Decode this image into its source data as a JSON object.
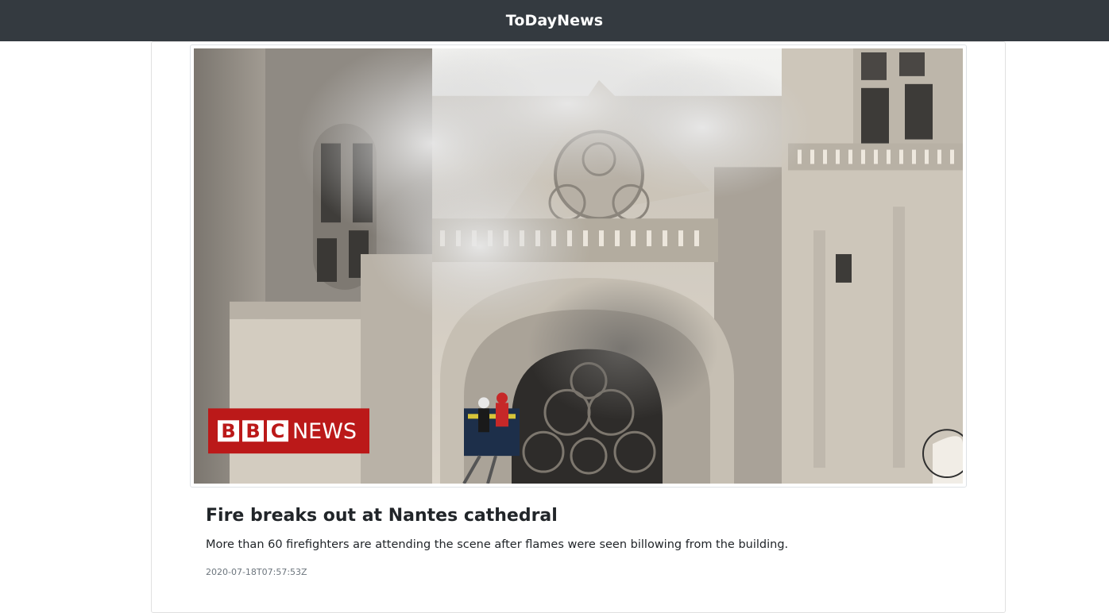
{
  "navbar": {
    "brand": "ToDayNews",
    "background": "#343a40"
  },
  "article": {
    "image": {
      "subject": "cathedral-fire-photo",
      "logo_letters": [
        "B",
        "B",
        "C"
      ],
      "logo_word": "NEWS",
      "logo_color": "#bb1919"
    },
    "title": "Fire breaks out at Nantes cathedral",
    "description": "More than 60 firefighters are attending the scene after flames were seen billowing from the building.",
    "published_at": "2020-07-18T07:57:53Z"
  }
}
